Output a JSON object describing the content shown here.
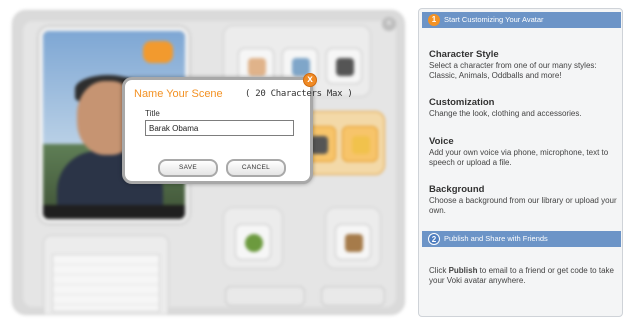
{
  "modal": {
    "title": "Name Your Scene",
    "subtitle": "( 20 Characters Max )",
    "field_label": "Title",
    "field_value": "Barak Obama",
    "save_label": "SAVE",
    "cancel_label": "CANCEL",
    "close_glyph": "x"
  },
  "help": {
    "step1": {
      "number": "1",
      "label": "Start Customizing Your Avatar"
    },
    "sections": [
      {
        "title": "Character Style",
        "text": "Select a character from one of our many styles: Classic, Animals, Oddballs and more!"
      },
      {
        "title": "Customization",
        "text": "Change the look, clothing and accessories."
      },
      {
        "title": "Voice",
        "text": "Add your own voice via phone, microphone, text to speech or upload a file."
      },
      {
        "title": "Background",
        "text": "Choose a background from our library or upload your own."
      }
    ],
    "step2": {
      "number": "2",
      "label": "Publish and Share with Friends"
    },
    "publish": {
      "pre": "Click ",
      "bold": "Publish",
      "post": " to email to a friend or get code to take your Voki avatar anywhere."
    }
  },
  "colors": {
    "accent_orange": "#f39224",
    "header_blue": "#6c94c7"
  },
  "icons": {
    "close": "close-icon",
    "step_badge": "step-number-icon"
  }
}
